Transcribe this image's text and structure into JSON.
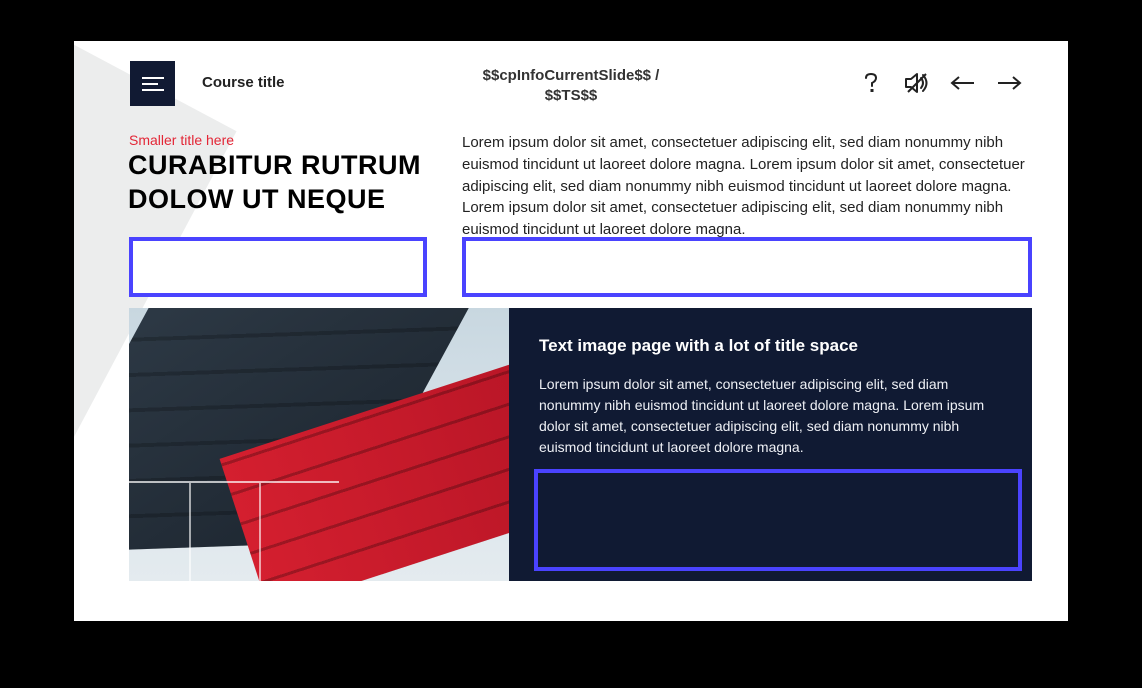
{
  "header": {
    "course_title": "Course title",
    "pager_line1": "$$cpInfoCurrentSlide$$ /",
    "pager_line2": "$$TS$$"
  },
  "left": {
    "small_title": "Smaller title here",
    "big_title": "CURABITUR RUTRUM DOLOW UT NEQUE"
  },
  "body": {
    "paragraph": "Lorem ipsum dolor sit amet, consectetuer adipiscing elit, sed diam nonummy nibh euismod tincidunt ut laoreet dolore magna. Lorem ipsum dolor sit amet, consectetuer adipiscing elit, sed diam nonummy nibh euismod tincidunt ut laoreet dolore magna. Lorem ipsum dolor sit amet, consectetuer adipiscing elit, sed diam nonummy nibh euismod tincidunt ut laoreet dolore magna."
  },
  "card": {
    "title": "Text image page with a lot of title space",
    "text": "Lorem ipsum dolor sit amet, consectetuer adipiscing elit, sed diam nonummy nibh euismod tincidunt ut laoreet dolore magna. Lorem ipsum dolor sit amet, consectetuer adipiscing elit, sed diam nonummy nibh euismod tincidunt ut laoreet dolore magna."
  },
  "colors": {
    "selection_border": "#4a43ff",
    "card_bg": "#101a33",
    "accent_red": "#e32636"
  }
}
